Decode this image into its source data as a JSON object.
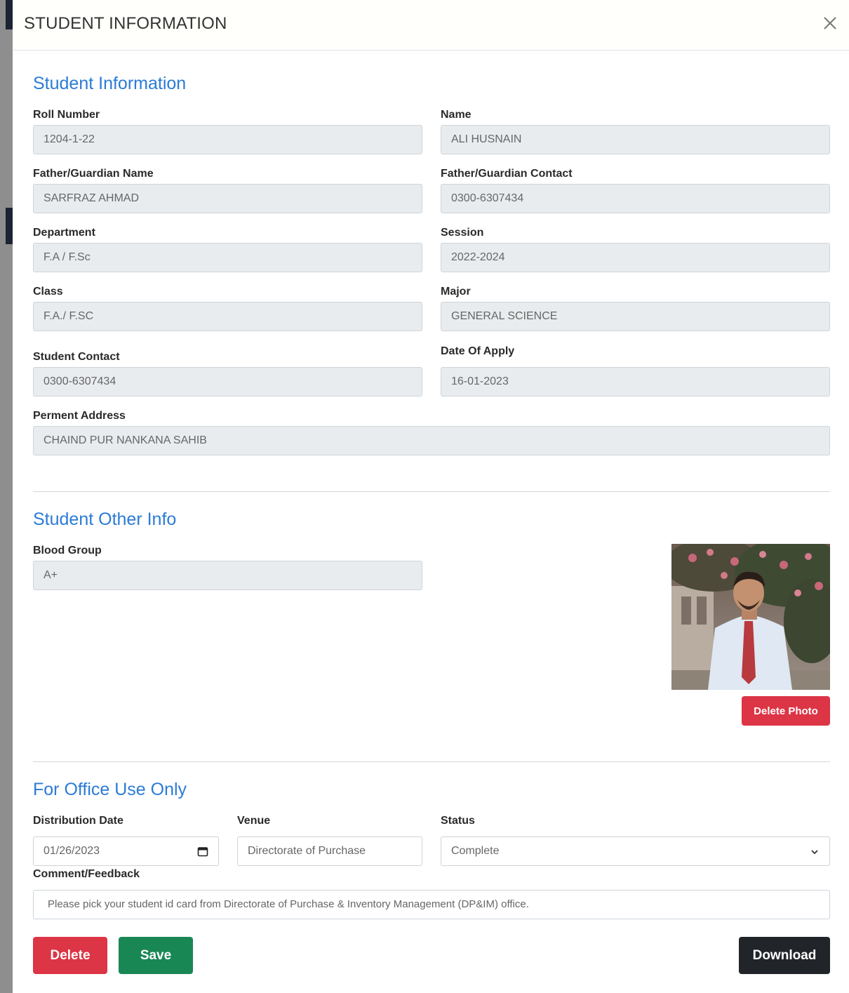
{
  "modal": {
    "title": "STUDENT INFORMATION"
  },
  "section1": {
    "title": "Student Information",
    "roll_number": {
      "label": "Roll Number",
      "value": "1204-1-22"
    },
    "name": {
      "label": "Name",
      "value": "ALI HUSNAIN"
    },
    "father_name": {
      "label": "Father/Guardian Name",
      "value": "SARFRAZ AHMAD"
    },
    "father_contact": {
      "label": "Father/Guardian Contact",
      "value": "0300-6307434"
    },
    "department": {
      "label": "Department",
      "value": "F.A / F.Sc"
    },
    "session": {
      "label": "Session",
      "value": "2022-2024"
    },
    "class": {
      "label": "Class",
      "value": "F.A./ F.SC"
    },
    "major": {
      "label": "Major",
      "value": "GENERAL SCIENCE"
    },
    "student_contact": {
      "label": "Student Contact",
      "value": "0300-6307434"
    },
    "date_of_apply": {
      "label": "Date Of Apply",
      "value": "16-01-2023"
    },
    "address": {
      "label": "Perment Address",
      "value": "CHAIND PUR NANKANA SAHIB"
    }
  },
  "section2": {
    "title": "Student Other Info",
    "blood_group": {
      "label": "Blood Group",
      "value": "A+"
    },
    "delete_photo_label": "Delete Photo"
  },
  "section3": {
    "title": "For Office Use Only",
    "distribution_date": {
      "label": "Distribution Date",
      "value": "01/26/2023"
    },
    "venue": {
      "label": "Venue",
      "value": "Directorate of Purchase"
    },
    "status": {
      "label": "Status",
      "value": "Complete"
    },
    "comment": {
      "label": "Comment/Feedback",
      "value": "Please pick your student id card from Directorate of Purchase & Inventory Management (DP&IM) office."
    }
  },
  "actions": {
    "delete_label": "Delete",
    "save_label": "Save",
    "download_label": "Download"
  },
  "colors": {
    "section_title": "#2b7bd6",
    "danger": "#dc3545",
    "success": "#198754",
    "dark": "#212529"
  }
}
